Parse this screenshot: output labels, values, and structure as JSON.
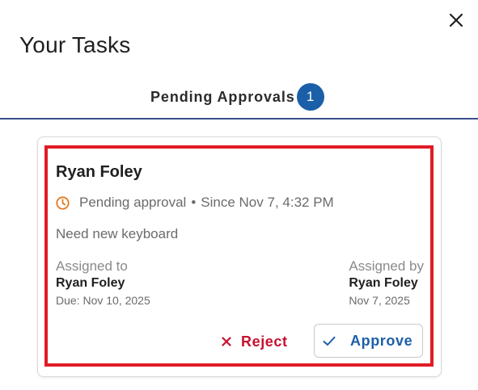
{
  "header": {
    "title": "Your Tasks",
    "close_icon": "close-icon"
  },
  "tabs": [
    {
      "label": "Pending Approvals",
      "badge": "1",
      "active": true
    }
  ],
  "task": {
    "requester": "Ryan Foley",
    "status_icon": "clock-icon",
    "status": "Pending approval",
    "separator": "•",
    "since": "Since Nov 7, 4:32 PM",
    "description": "Need new keyboard",
    "assigned_to": {
      "caption": "Assigned to",
      "name": "Ryan Foley",
      "date": "Due: Nov 10, 2025"
    },
    "assigned_by": {
      "caption": "Assigned by",
      "name": "Ryan Foley",
      "date": "Nov 7, 2025"
    },
    "actions": {
      "reject_label": "Reject",
      "approve_label": "Approve"
    }
  },
  "colors": {
    "accent_blue": "#1b5fa8",
    "reject_red": "#c8102e",
    "highlight_border": "#e01b24",
    "clock_orange": "#e07a1f"
  }
}
